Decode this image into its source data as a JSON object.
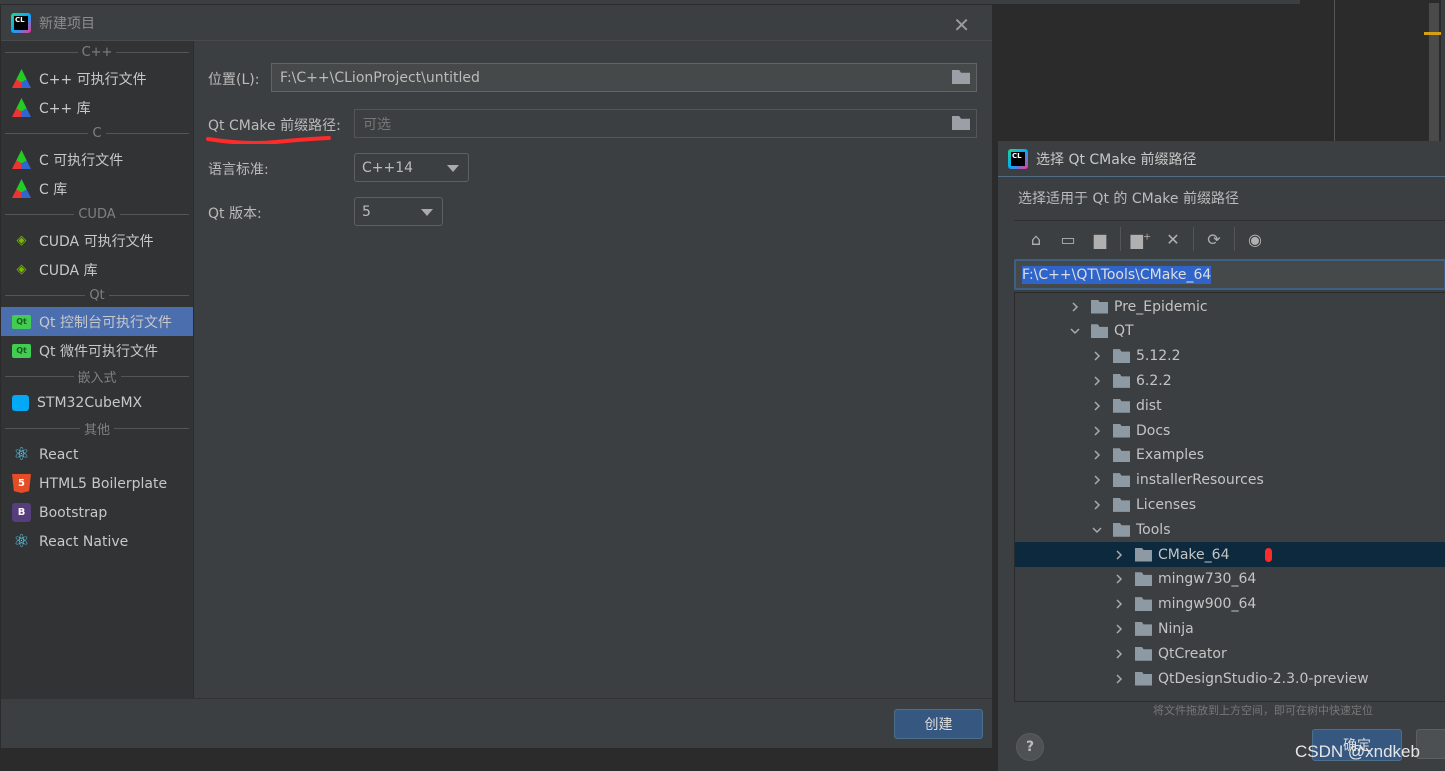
{
  "main_dialog": {
    "title": "新建项目",
    "close_icon": "close-icon",
    "sidebar": [
      {
        "group": "C++",
        "items": [
          {
            "label": "C++ 可执行文件",
            "icon": "cmake-triangle"
          },
          {
            "label": "C++ 库",
            "icon": "cmake-triangle"
          }
        ]
      },
      {
        "group": "C",
        "items": [
          {
            "label": "C 可执行文件",
            "icon": "cmake-triangle"
          },
          {
            "label": "C 库",
            "icon": "cmake-triangle"
          }
        ]
      },
      {
        "group": "CUDA",
        "items": [
          {
            "label": "CUDA 可执行文件",
            "icon": "nvidia"
          },
          {
            "label": "CUDA 库",
            "icon": "nvidia"
          }
        ]
      },
      {
        "group": "Qt",
        "items": [
          {
            "label": "Qt 控制台可执行文件",
            "icon": "qt",
            "selected": true
          },
          {
            "label": "Qt 微件可执行文件",
            "icon": "qt"
          }
        ]
      },
      {
        "group": "嵌入式",
        "items": [
          {
            "label": "STM32CubeMX",
            "icon": "cube"
          }
        ]
      },
      {
        "group": "其他",
        "items": [
          {
            "label": "React",
            "icon": "react"
          },
          {
            "label": "HTML5 Boilerplate",
            "icon": "html5"
          },
          {
            "label": "Bootstrap",
            "icon": "bootstrap"
          },
          {
            "label": "React Native",
            "icon": "react"
          }
        ]
      }
    ],
    "form": {
      "location_label": "位置(L):",
      "location_value": "F:\\C++\\CLionProject\\untitled",
      "qt_prefix_label": "Qt CMake 前缀路径:",
      "qt_prefix_placeholder": "可选",
      "lang_label": "语言标准:",
      "lang_value": "C++14",
      "qt_version_label": "Qt 版本:",
      "qt_version_value": "5"
    },
    "create_button": "创建"
  },
  "chooser_dialog": {
    "title": "选择 Qt CMake 前缀路径",
    "description": "选择适用于 Qt 的 CMake 前缀路径",
    "toolbar": [
      "home-icon",
      "desktop-icon",
      "project-folder-icon",
      "new-folder-icon",
      "delete-icon",
      "refresh-icon",
      "show-hidden-icon"
    ],
    "path_value": "F:\\C++\\QT\\Tools\\CMake_64",
    "tree": [
      {
        "label": "Pre_Epidemic",
        "level": 0,
        "expanded": false
      },
      {
        "label": "QT",
        "level": 0,
        "expanded": true
      },
      {
        "label": "5.12.2",
        "level": 1,
        "expanded": false
      },
      {
        "label": "6.2.2",
        "level": 1,
        "expanded": false
      },
      {
        "label": "dist",
        "level": 1,
        "expanded": false
      },
      {
        "label": "Docs",
        "level": 1,
        "expanded": false
      },
      {
        "label": "Examples",
        "level": 1,
        "expanded": false
      },
      {
        "label": "installerResources",
        "level": 1,
        "expanded": false
      },
      {
        "label": "Licenses",
        "level": 1,
        "expanded": false
      },
      {
        "label": "Tools",
        "level": 1,
        "expanded": true
      },
      {
        "label": "CMake_64",
        "level": 2,
        "expanded": false,
        "selected": true
      },
      {
        "label": "mingw730_64",
        "level": 2,
        "expanded": false
      },
      {
        "label": "mingw900_64",
        "level": 2,
        "expanded": false
      },
      {
        "label": "Ninja",
        "level": 2,
        "expanded": false
      },
      {
        "label": "QtCreator",
        "level": 2,
        "expanded": false
      },
      {
        "label": "QtDesignStudio-2.3.0-preview",
        "level": 2,
        "expanded": false
      }
    ],
    "hint": "将文件拖放到上方空间，即可在树中快速定位",
    "ok_button": "确定",
    "help": "?"
  },
  "watermark": "CSDN @xndkeb",
  "colors": {
    "accent": "#4b6eaf",
    "button": "#365880",
    "selection": "#0d293e",
    "annotation": "#ff2a2a"
  }
}
